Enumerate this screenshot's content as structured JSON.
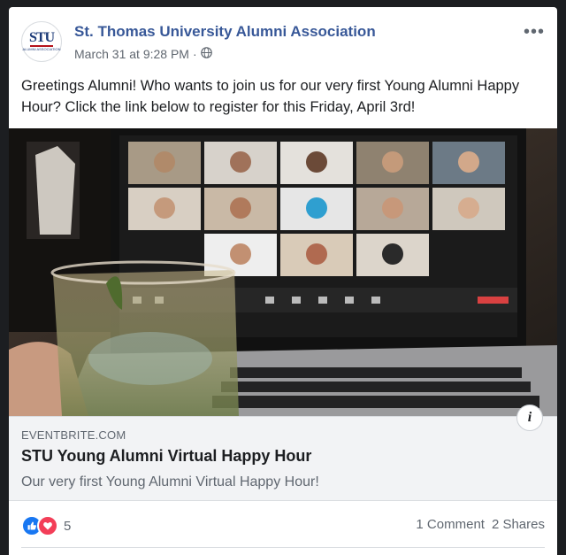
{
  "post": {
    "page_name": "St. Thomas University Alumni Association",
    "timestamp": "March 31 at 9:28 PM",
    "separator": "·",
    "audience_icon": "globe-icon",
    "more_label": "•••",
    "text": "Greetings Alumni! Who wants to join us for our very first Young Alumni Happy Hour? Click the link below to register for this Friday, April 3rd!"
  },
  "avatar": {
    "monogram": "STU",
    "subtitle": "ALUMNI ASSOCIATION"
  },
  "link_preview": {
    "domain": "EVENTBRITE.COM",
    "title": "STU Young Alumni Virtual Happy Hour",
    "description": "Our very first Young Alumni Virtual Happy Hour!",
    "info_label": "i"
  },
  "footer": {
    "reaction_count": "5",
    "comments": "1 Comment",
    "shares": "2 Shares"
  },
  "colors": {
    "link_blue": "#385898",
    "like_blue": "#1877f2",
    "love_red": "#f33e58",
    "meta_gray": "#606770"
  }
}
